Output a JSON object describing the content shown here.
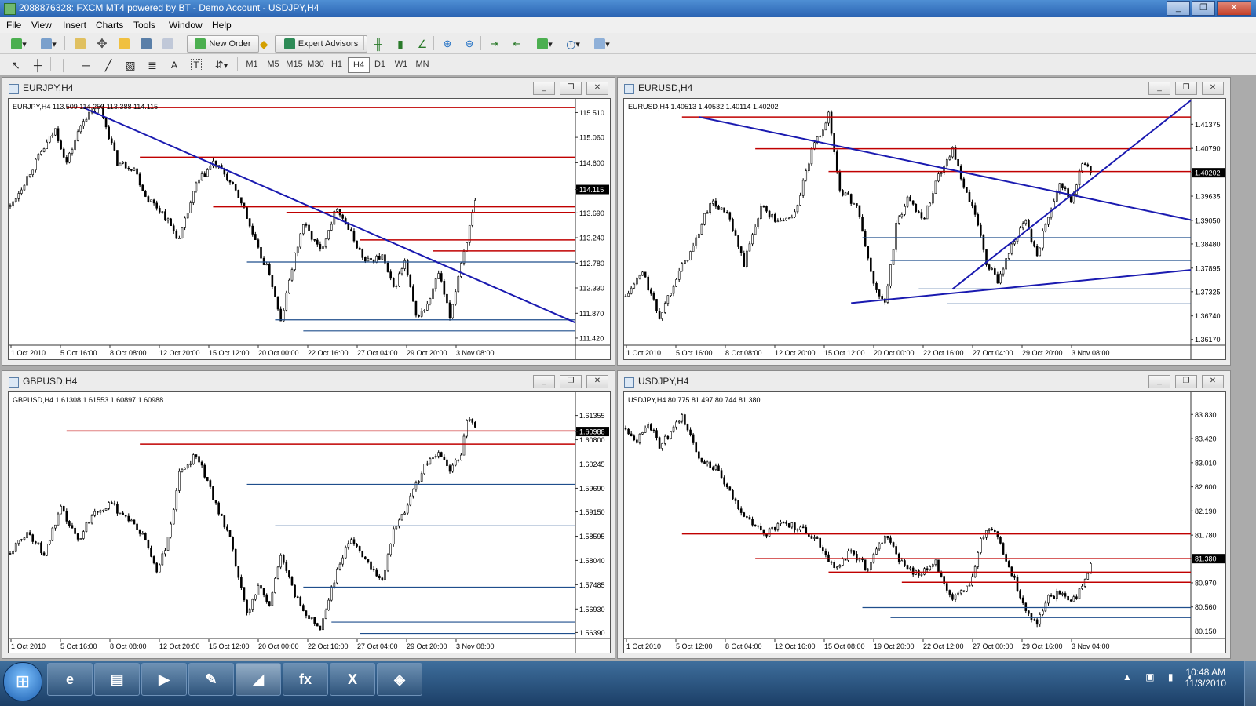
{
  "window": {
    "title": "2088876328: FXCM MT4 powered by BT - Demo Account - USDJPY,H4",
    "minimize": "_",
    "restore": "❐",
    "close": "✕"
  },
  "menu": [
    "File",
    "View",
    "Insert",
    "Charts",
    "Tools",
    "Window",
    "Help"
  ],
  "toolbar": {
    "new_order": "New Order",
    "expert_advisors": "Expert Advisors",
    "draw_text_icon": "A",
    "text_label_icon": "T",
    "timeframes": [
      "M1",
      "M5",
      "M15",
      "M30",
      "H1",
      "H4",
      "D1",
      "W1",
      "MN"
    ],
    "active_timeframe": "H4"
  },
  "charts": [
    {
      "title": "EURJPY,H4",
      "ohlc": "EURJPY,H4  113.509 114.250 113.388 114.115",
      "price_labels": [
        "115.510",
        "115.060",
        "114.600",
        "114.115",
        "113.690",
        "113.240",
        "112.780",
        "112.330",
        "111.870",
        "111.420"
      ],
      "current_price": "114.115",
      "time_labels": [
        "1 Oct 2010",
        "5 Oct 16:00",
        "8 Oct 08:00",
        "12 Oct 20:00",
        "15 Oct 12:00",
        "20 Oct 00:00",
        "22 Oct 16:00",
        "27 Oct 04:00",
        "29 Oct 20:00",
        "3 Nov 08:00"
      ],
      "chart_data": {
        "type": "candlestick",
        "symbol": "EURJPY",
        "timeframe": "H4",
        "ylim": [
          111.32,
          115.73
        ],
        "last_close": 114.115,
        "path_x": [
          0,
          0.05,
          0.08,
          0.1,
          0.13,
          0.16,
          0.19,
          0.22,
          0.24,
          0.27,
          0.3,
          0.33,
          0.36,
          0.38,
          0.41,
          0.44,
          0.46,
          0.48,
          0.5,
          0.52,
          0.55,
          0.58,
          0.61,
          0.63,
          0.66,
          0.68,
          0.7,
          0.72,
          0.74,
          0.76,
          0.78,
          0.8,
          0.81,
          0.83
        ],
        "path_y": [
          113.8,
          114.7,
          115.2,
          114.6,
          115.4,
          115.6,
          114.6,
          114.5,
          114.0,
          113.7,
          113.2,
          114.2,
          114.6,
          114.4,
          113.9,
          113.0,
          112.6,
          111.7,
          112.7,
          113.5,
          113.0,
          113.8,
          113.2,
          112.8,
          112.9,
          112.3,
          112.8,
          111.8,
          112.0,
          112.6,
          111.8,
          112.8,
          113.2,
          114.1
        ],
        "resistance_levels": [
          115.6,
          114.7,
          113.8,
          113.7,
          113.2,
          113.0
        ],
        "support_levels": [
          112.8,
          111.75,
          111.55
        ],
        "trendlines": [
          [
            115.6,
            111.7
          ]
        ]
      }
    },
    {
      "title": "EURUSD,H4",
      "ohlc": "EURUSD,H4  1.40513 1.40532 1.40114 1.40202",
      "price_labels": [
        "1.41375",
        "1.40790",
        "1.40202",
        "1.39635",
        "1.39050",
        "1.38480",
        "1.37895",
        "1.37325",
        "1.36740",
        "1.36170"
      ],
      "current_price": "1.40202",
      "time_labels": [
        "1 Oct 2010",
        "5 Oct 16:00",
        "8 Oct 08:00",
        "12 Oct 20:00",
        "15 Oct 12:00",
        "20 Oct 00:00",
        "22 Oct 16:00",
        "27 Oct 04:00",
        "29 Oct 20:00",
        "3 Nov 08:00"
      ],
      "chart_data": {
        "type": "candlestick",
        "symbol": "EURUSD",
        "timeframe": "H4",
        "ylim": [
          1.3607,
          1.4195
        ],
        "last_close": 1.40202,
        "path_x": [
          0,
          0.03,
          0.06,
          0.09,
          0.12,
          0.15,
          0.18,
          0.21,
          0.24,
          0.27,
          0.3,
          0.33,
          0.36,
          0.38,
          0.41,
          0.44,
          0.46,
          0.48,
          0.5,
          0.53,
          0.55,
          0.58,
          0.6,
          0.62,
          0.64,
          0.66,
          0.69,
          0.71,
          0.73,
          0.75,
          0.77,
          0.79,
          0.81,
          0.83
        ],
        "path_y": [
          1.372,
          1.378,
          1.367,
          1.377,
          1.384,
          1.395,
          1.392,
          1.38,
          1.394,
          1.39,
          1.392,
          1.407,
          1.416,
          1.398,
          1.394,
          1.375,
          1.37,
          1.389,
          1.396,
          1.391,
          1.4,
          1.408,
          1.398,
          1.392,
          1.38,
          1.376,
          1.386,
          1.39,
          1.382,
          1.392,
          1.4,
          1.395,
          1.404,
          1.402
        ],
        "resistance_levels": [
          1.4155,
          1.4078,
          1.4023
        ],
        "support_levels": [
          1.3863,
          1.3808,
          1.3739,
          1.3703
        ],
        "trendlines": [
          [
            1.4155,
            1.3906
          ],
          [
            1.3705,
            1.3785
          ],
          [
            1.3739,
            1.4195
          ]
        ]
      }
    },
    {
      "title": "GBPUSD,H4",
      "ohlc": "GBPUSD,H4  1.61308 1.61553 1.60897 1.60988",
      "price_labels": [
        "1.61355",
        "1.60988",
        "1.60800",
        "1.60245",
        "1.59690",
        "1.59150",
        "1.58595",
        "1.58040",
        "1.57485",
        "1.56930",
        "1.56390"
      ],
      "current_price": "1.60988",
      "time_labels": [
        "1 Oct 2010",
        "5 Oct 16:00",
        "8 Oct 08:00",
        "12 Oct 20:00",
        "15 Oct 12:00",
        "20 Oct 00:00",
        "22 Oct 16:00",
        "27 Oct 04:00",
        "29 Oct 20:00",
        "3 Nov 08:00"
      ],
      "chart_data": {
        "type": "candlestick",
        "symbol": "GBPUSD",
        "timeframe": "H4",
        "ylim": [
          1.5629,
          1.6185
        ],
        "last_close": 1.60988,
        "path_x": [
          0,
          0.03,
          0.06,
          0.09,
          0.12,
          0.15,
          0.18,
          0.21,
          0.24,
          0.26,
          0.28,
          0.3,
          0.33,
          0.36,
          0.39,
          0.42,
          0.44,
          0.46,
          0.48,
          0.5,
          0.52,
          0.55,
          0.57,
          0.6,
          0.62,
          0.64,
          0.66,
          0.68,
          0.7,
          0.72,
          0.74,
          0.76,
          0.78,
          0.8,
          0.81,
          0.83
        ],
        "path_y": [
          1.582,
          1.587,
          1.582,
          1.592,
          1.585,
          1.592,
          1.593,
          1.59,
          1.585,
          1.578,
          1.585,
          1.6,
          1.605,
          1.595,
          1.585,
          1.568,
          1.575,
          1.57,
          1.582,
          1.574,
          1.569,
          1.565,
          1.574,
          1.585,
          1.583,
          1.579,
          1.576,
          1.587,
          1.592,
          1.598,
          1.603,
          1.605,
          1.601,
          1.605,
          1.613,
          1.61
        ],
        "resistance_levels": [
          1.61,
          1.607
        ],
        "support_levels": [
          1.5978,
          1.5883,
          1.5743,
          1.5663,
          1.5637
        ],
        "trendlines": []
      }
    },
    {
      "title": "USDJPY,H4",
      "ohlc": "USDJPY,H4  80.775 81.497 80.744 81.380",
      "price_labels": [
        "83.830",
        "83.420",
        "83.010",
        "82.600",
        "82.190",
        "81.780",
        "81.380",
        "80.970",
        "80.560",
        "80.150"
      ],
      "current_price": "81.380",
      "time_labels": [
        "1 Oct 2010",
        "5 Oct 12:00",
        "8 Oct 04:00",
        "12 Oct 16:00",
        "15 Oct 08:00",
        "19 Oct 20:00",
        "22 Oct 12:00",
        "27 Oct 00:00",
        "29 Oct 16:00",
        "3 Nov 04:00"
      ],
      "chart_data": {
        "type": "candlestick",
        "symbol": "USDJPY",
        "timeframe": "H4",
        "ylim": [
          80.05,
          84.18
        ],
        "last_close": 81.38,
        "path_x": [
          0,
          0.02,
          0.04,
          0.06,
          0.08,
          0.1,
          0.13,
          0.16,
          0.19,
          0.22,
          0.25,
          0.28,
          0.31,
          0.34,
          0.37,
          0.4,
          0.43,
          0.46,
          0.49,
          0.52,
          0.55,
          0.58,
          0.61,
          0.63,
          0.65,
          0.67,
          0.69,
          0.71,
          0.73,
          0.75,
          0.77,
          0.79,
          0.81,
          0.82,
          0.83
        ],
        "path_y": [
          83.6,
          83.4,
          83.7,
          83.3,
          83.5,
          83.8,
          83.1,
          82.9,
          82.4,
          82.0,
          81.8,
          82.0,
          81.9,
          81.7,
          81.2,
          81.5,
          81.2,
          81.8,
          81.3,
          81.1,
          81.3,
          80.7,
          80.9,
          81.7,
          81.9,
          81.5,
          81.0,
          80.5,
          80.3,
          80.7,
          80.8,
          80.6,
          80.9,
          81.1,
          81.38
        ],
        "resistance_levels": [
          81.8,
          81.38,
          81.15,
          80.98
        ],
        "support_levels": [
          80.55,
          80.38
        ],
        "trendlines": []
      }
    }
  ],
  "taskbar": {
    "start": "⊞",
    "apps": [
      "e",
      "▤",
      "▶",
      "✎",
      "◢",
      "fx",
      "X",
      "◈"
    ],
    "tray_icons": "▲ ▣ ▮ ◖",
    "time": "10:48 AM",
    "date": "11/3/2010"
  }
}
